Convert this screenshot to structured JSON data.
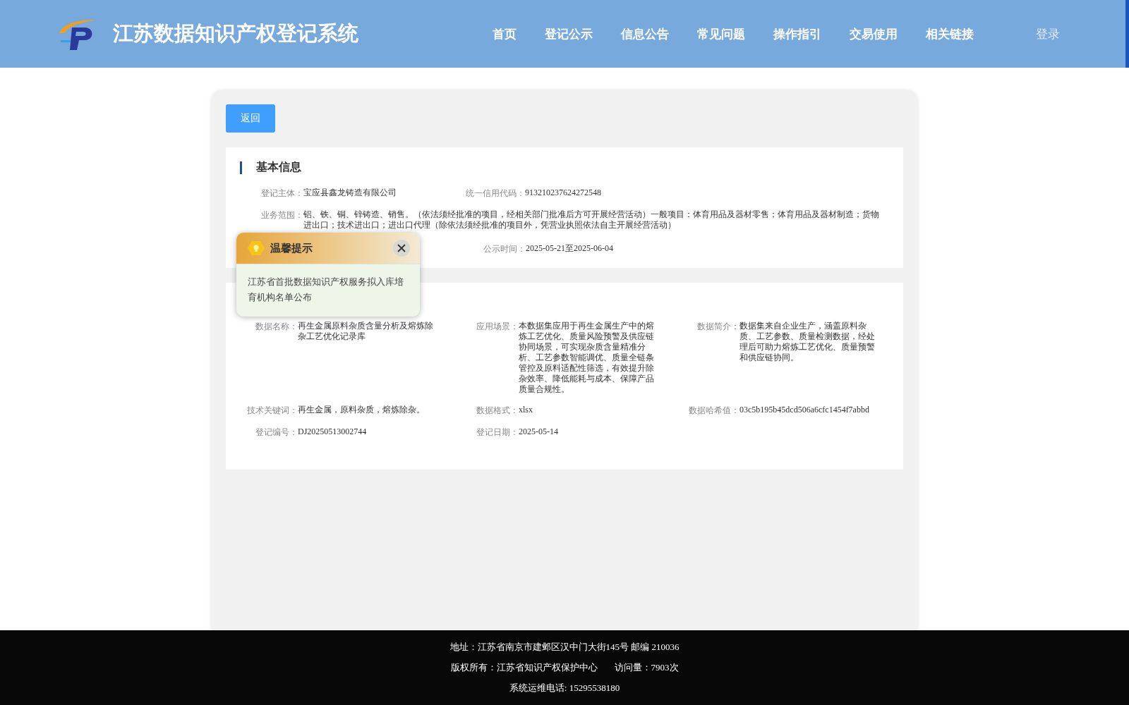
{
  "header": {
    "title": "江苏数据知识产权登记系统",
    "nav": [
      {
        "label": "首页",
        "selected": false
      },
      {
        "label": "登记公示",
        "selected": false
      },
      {
        "label": "信息公告",
        "selected": false
      },
      {
        "label": "常见问题",
        "selected": false
      },
      {
        "label": "操作指引",
        "selected": false
      },
      {
        "label": "交易使用",
        "selected": false
      },
      {
        "label": "相关链接",
        "selected": false
      }
    ],
    "login": "登录"
  },
  "back_button": "返回",
  "basic_info": {
    "title": "基本信息",
    "fields": [
      {
        "label": "登记主体：",
        "value": "宝应县鑫龙铸造有限公司",
        "kind": "half"
      },
      {
        "label": "统一信用代码：",
        "value": "913210237624272548",
        "kind": "half"
      },
      {
        "label": "业务范围：",
        "value": "铝、铁、铜、锌铸造、销售。（依法须经批准的项目，经相关部门批准后方可开展经营活动）一般项目：体育用品及器材零售；体育用品及器材制造；货物进出口；技术进出口；进出口代理（除依法须经批准的项目外，凭营业执照依法自主开展经营活动）",
        "kind": "full"
      },
      {
        "label": "公示时间：",
        "value": "2025-05-21至2025-06-04",
        "kind": "right"
      }
    ]
  },
  "registration_info": {
    "fields": [
      {
        "label": "数据名称：",
        "value": "再生金属原料杂质含量分析及熔炼除杂工艺优化记录库"
      },
      {
        "label": "应用场景：",
        "value": "本数据集应用于再生金属生产中的熔炼工艺优化、质量风险预警及供应链协同场景，可实现杂质含量精准分析、工艺参数智能调优、质量全链条管控及原料适配性筛选，有效提升除杂效率、降低能耗与成本、保障产品质量合规性。"
      },
      {
        "label": "数据简介：",
        "value": "数据集来自企业生产，涵盖原料杂质、工艺参数、质量检测数据，经处理后可助力熔炼工艺优化、质量预警和供应链协同。"
      },
      {
        "label": "技术关键词：",
        "value": "再生金属，原料杂质，熔炼除杂。"
      },
      {
        "label": "数据格式：",
        "value": "xlsx"
      },
      {
        "label": "数据哈希值：",
        "value": "03c5b195b45dcd506a6cfc1454f7abbd"
      },
      {
        "label": "登记编号：",
        "value": "DJ20250513002744"
      },
      {
        "label": "登记日期：",
        "value": "2025-05-14"
      }
    ]
  },
  "notice_popup": {
    "title": "温馨提示",
    "message": "江苏省首批数据知识产权服务拟入库培育机构名单公布"
  },
  "footer": {
    "lines": [
      "地址：江苏省南京市建邺区汉中门大街145号 邮编 210036",
      "版权所有：江苏省知识产权保护中心",
      "访问量：7903次",
      "系统运维电话: 15295538180"
    ]
  }
}
